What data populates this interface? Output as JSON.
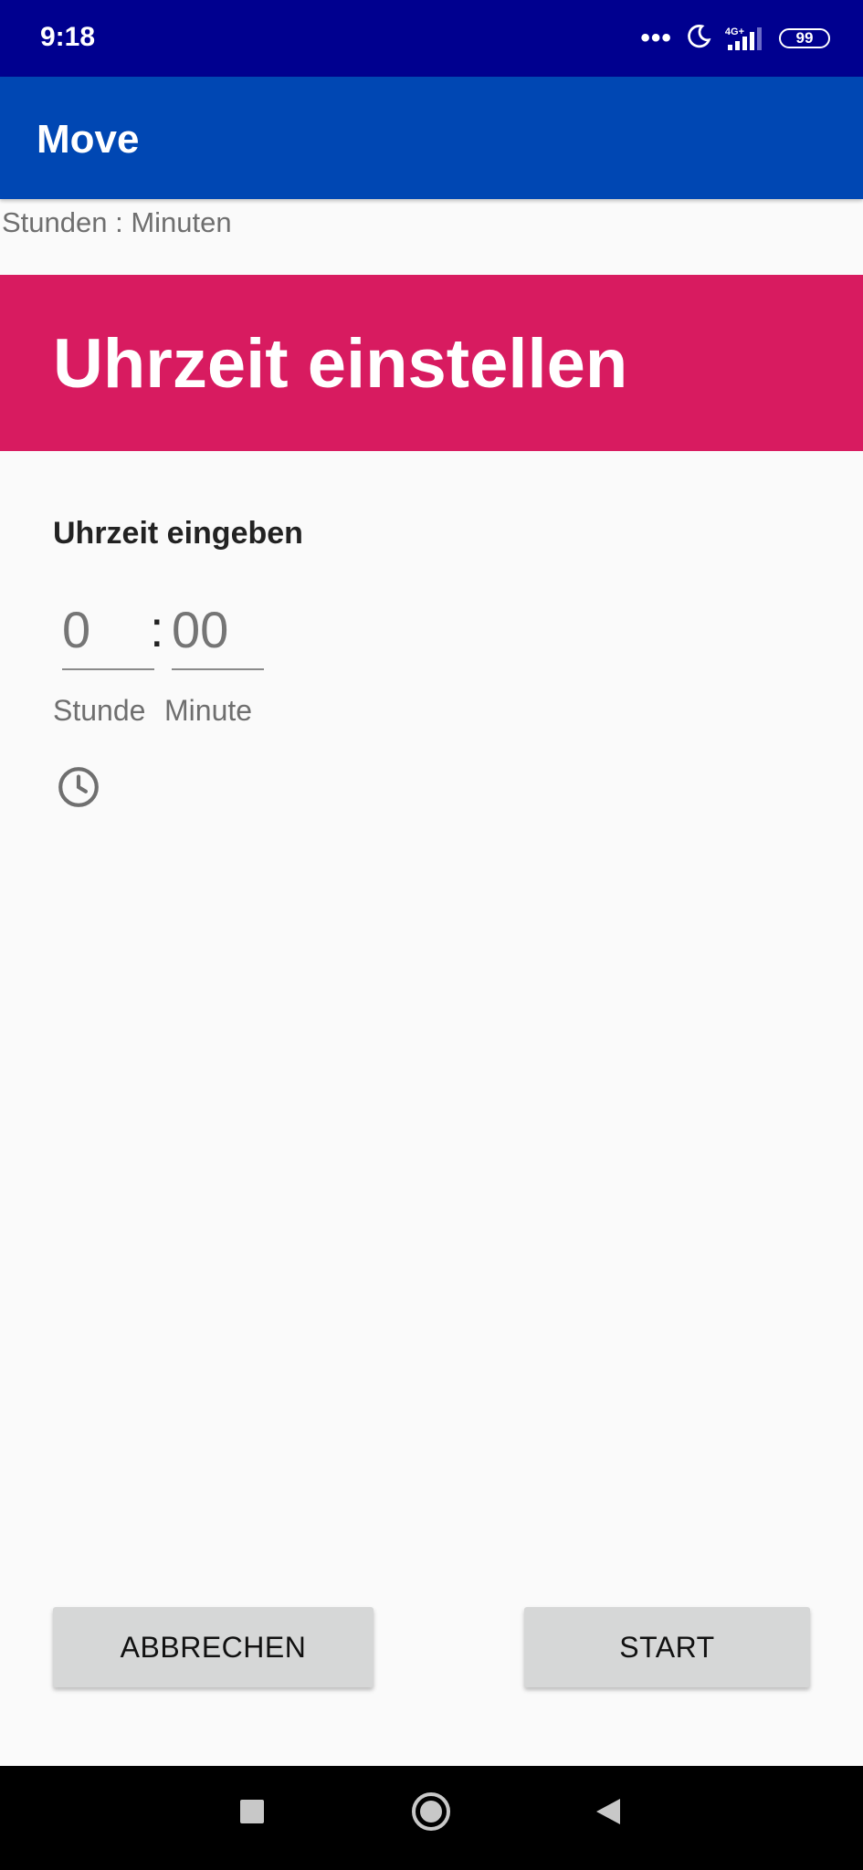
{
  "status_bar": {
    "time": "9:18",
    "network": "4G+",
    "battery": "99",
    "icons": [
      "more-dots-icon",
      "moon-icon",
      "signal-icon",
      "battery-icon"
    ]
  },
  "app_bar": {
    "title": "Move"
  },
  "subtitle": "Stunden : Minuten",
  "dialog": {
    "title": "Uhrzeit einstellen",
    "section_label": "Uhrzeit eingeben",
    "hour": {
      "value": "",
      "placeholder": "0",
      "label": "Stunde"
    },
    "separator": ":",
    "minute": {
      "value": "",
      "placeholder": "00",
      "label": "Minute"
    },
    "toggle_icon": "clock-icon",
    "header_color": "#d81b60"
  },
  "buttons": {
    "cancel": "ABBRECHEN",
    "start": "START"
  },
  "nav_bar": {
    "icons": [
      "recents-square-icon",
      "home-circle-icon",
      "back-triangle-icon"
    ]
  },
  "colors": {
    "status_bar": "#00008f",
    "app_bar": "#0047b3",
    "accent": "#d81b60",
    "background": "#fafafa"
  }
}
